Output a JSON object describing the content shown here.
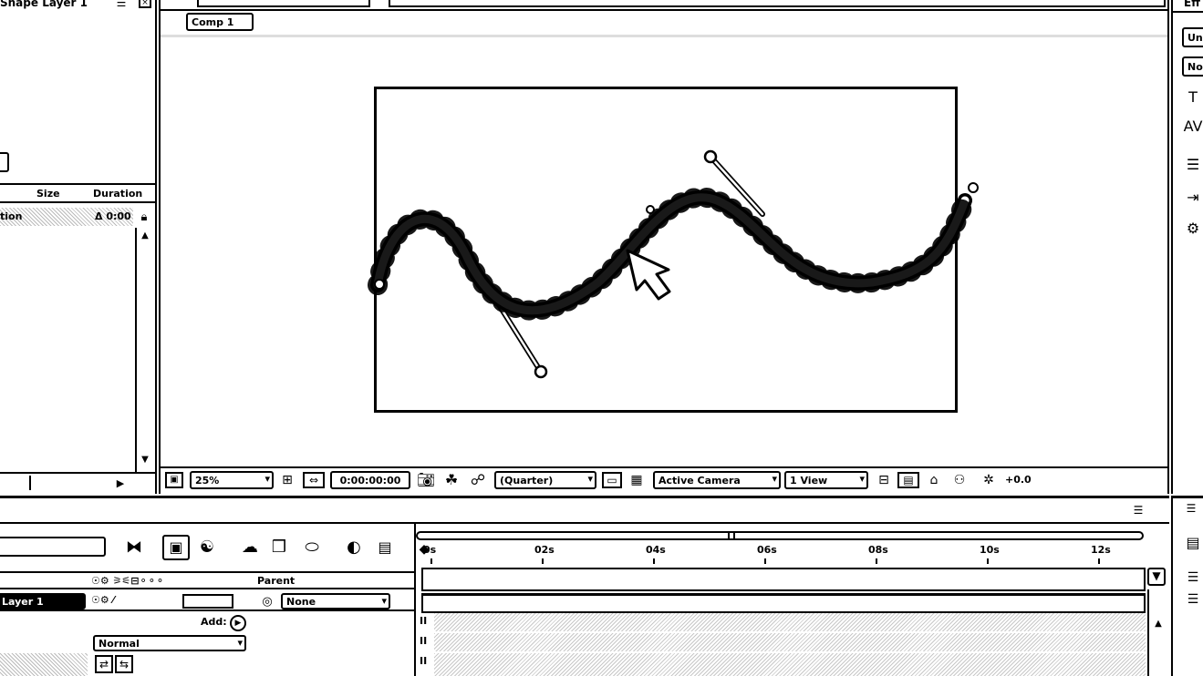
{
  "project_panel": {
    "title": "Shape Layer 1",
    "columns": [
      "Size",
      "Duration"
    ],
    "row": {
      "name": "tion",
      "duration": "Δ 0:00"
    }
  },
  "composition": {
    "tab_label": "Comp 1",
    "zoom": "25%",
    "timecode": "0:00:00:00",
    "resolution": "(Quarter)",
    "camera": "Active Camera",
    "views": "1 View",
    "exposure": "+0.0"
  },
  "right_panel": {
    "header": "Eff",
    "items": [
      "Un",
      "No"
    ]
  },
  "timeline": {
    "search_placeholder": "",
    "ruler_ticks": [
      "0s",
      "02s",
      "04s",
      "06s",
      "08s",
      "10s",
      "12s"
    ],
    "column_header_parent": "Parent",
    "layer": {
      "name": "Layer 1",
      "parent": "None",
      "add_label": "Add:",
      "blend_mode": "Normal"
    }
  },
  "colors": {
    "ink": "#000000",
    "paper": "#ffffff",
    "dither": "#bbbbbb"
  }
}
